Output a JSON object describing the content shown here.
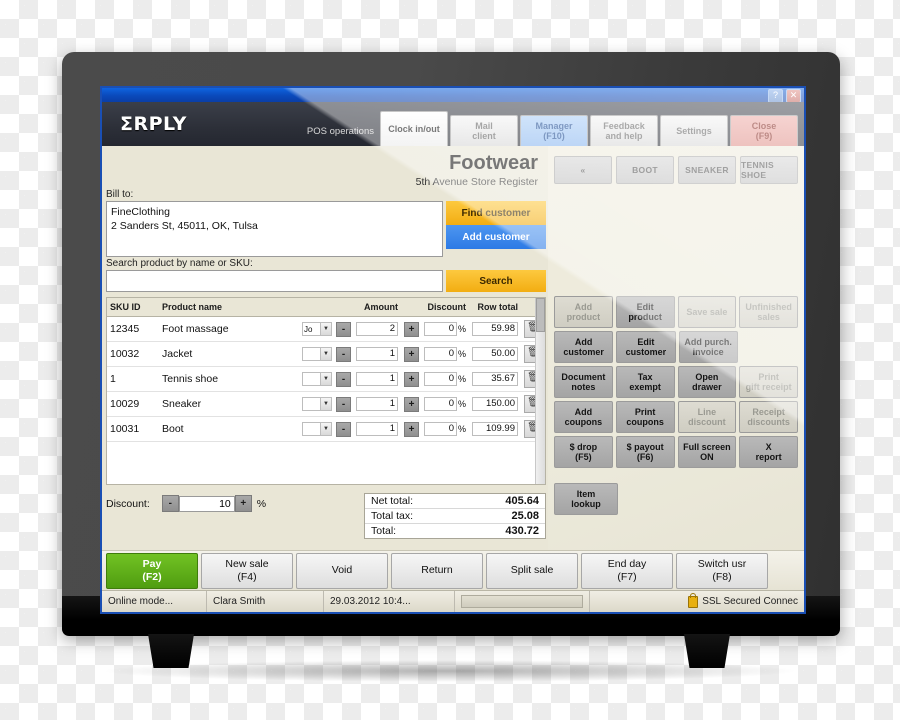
{
  "window": {
    "help_label": "?",
    "close_label": "✕"
  },
  "header": {
    "logo": "ΣRPLY",
    "pos_operations_label": "POS operations",
    "nav": [
      {
        "label": "Clock in/out",
        "sub": "",
        "style": "active"
      },
      {
        "label": "Mail",
        "sub": "client",
        "style": "normal"
      },
      {
        "label": "Manager",
        "sub": "(F10)",
        "style": "blue"
      },
      {
        "label": "Feedback",
        "sub": "and help",
        "style": "normal"
      },
      {
        "label": "Settings",
        "sub": "",
        "style": "normal"
      },
      {
        "label": "Close",
        "sub": "(F9)",
        "style": "red"
      }
    ]
  },
  "store": {
    "title": "Footwear",
    "subtitle": "5th Avenue Store Register"
  },
  "customer": {
    "bill_to_label": "Bill to:",
    "name": "FineClothing",
    "address": "2 Sanders St, 45011, OK, Tulsa",
    "find_button": "Find customer",
    "add_button": "Add customer"
  },
  "search": {
    "label": "Search product by name or SKU:",
    "value": "",
    "placeholder": "",
    "button": "Search"
  },
  "products": {
    "columns": [
      "SKU ID",
      "Product name",
      "",
      "",
      "Amount",
      "",
      "Discount",
      "Row total",
      ""
    ],
    "headers": {
      "sku": "SKU ID",
      "name": "Product name",
      "amount": "Amount",
      "discount": "Discount",
      "row_total": "Row total"
    },
    "delete_icon": "🗑",
    "minus_label": "-",
    "plus_label": "+",
    "dropdown_arrow": "▼",
    "percent_symbol": "%",
    "rows": [
      {
        "sku": "12345",
        "name": "Foot massage",
        "variant": "Jo",
        "amount": "2",
        "discount": "0",
        "row_total": "59.98"
      },
      {
        "sku": "10032",
        "name": "Jacket",
        "variant": "",
        "amount": "1",
        "discount": "0",
        "row_total": "50.00"
      },
      {
        "sku": "1",
        "name": "Tennis shoe",
        "variant": "",
        "amount": "1",
        "discount": "0",
        "row_total": "35.67"
      },
      {
        "sku": "10029",
        "name": "Sneaker",
        "variant": "",
        "amount": "1",
        "discount": "0",
        "row_total": "150.00"
      },
      {
        "sku": "10031",
        "name": "Boot",
        "variant": "",
        "amount": "1",
        "discount": "0",
        "row_total": "109.99"
      }
    ]
  },
  "discount": {
    "label": "Discount:",
    "minus_label": "-",
    "plus_label": "+",
    "value": "10",
    "unit": "%"
  },
  "totals": [
    {
      "label": "Net total:",
      "value": "405.64"
    },
    {
      "label": "Total tax:",
      "value": "25.08"
    },
    {
      "label": "Total:",
      "value": "430.72"
    }
  ],
  "actions": [
    {
      "label": "Pay",
      "sub": "(F2)",
      "style": "green"
    },
    {
      "label": "New sale",
      "sub": "(F4)",
      "style": "normal"
    },
    {
      "label": "Void",
      "sub": "",
      "style": "normal"
    },
    {
      "label": "Return",
      "sub": "",
      "style": "normal"
    },
    {
      "label": "Split sale",
      "sub": "",
      "style": "normal"
    },
    {
      "label": "End day",
      "sub": "(F7)",
      "style": "normal"
    },
    {
      "label": "Switch usr",
      "sub": "(F8)",
      "style": "normal"
    }
  ],
  "status": {
    "mode": "Online mode...",
    "user": "Clara Smith",
    "time": "29.03.2012 10:4...",
    "ssl": "SSL Secured Connec"
  },
  "product_tabs": [
    {
      "label": "«"
    },
    {
      "label": "BOOT"
    },
    {
      "label": "SNEAKER"
    },
    {
      "label": "TENNIS SHOE"
    }
  ],
  "function_buttons": [
    [
      {
        "label": "Add product",
        "sub": "",
        "style": "dim"
      },
      {
        "label": "Edit",
        "sub": "product",
        "style": "normal"
      },
      {
        "label": "Save sale",
        "sub": "",
        "style": "dim"
      },
      {
        "label": "Unfinished",
        "sub": "sales",
        "style": "dim"
      }
    ],
    [
      {
        "label": "Add",
        "sub": "customer",
        "style": "normal"
      },
      {
        "label": "Edit",
        "sub": "customer",
        "style": "normal"
      },
      {
        "label": "Add purch.",
        "sub": "invoice",
        "style": "normal"
      },
      {
        "label": "",
        "sub": "",
        "style": "blank"
      }
    ],
    [
      {
        "label": "Document",
        "sub": "notes",
        "style": "normal"
      },
      {
        "label": "Tax",
        "sub": "exempt",
        "style": "normal"
      },
      {
        "label": "Open",
        "sub": "drawer",
        "style": "normal"
      },
      {
        "label": "Print",
        "sub": "gift receipt",
        "style": "dim"
      }
    ],
    [
      {
        "label": "Add",
        "sub": "coupons",
        "style": "normal"
      },
      {
        "label": "Print",
        "sub": "coupons",
        "style": "normal"
      },
      {
        "label": "Line",
        "sub": "discount",
        "style": "dim"
      },
      {
        "label": "Receipt",
        "sub": "discounts",
        "style": "dim"
      }
    ],
    [
      {
        "label": "$ drop",
        "sub": "(F5)",
        "style": "normal"
      },
      {
        "label": "$ payout",
        "sub": "(F6)",
        "style": "normal"
      },
      {
        "label": "Full screen",
        "sub": "ON",
        "style": "normal"
      },
      {
        "label": "X",
        "sub": "report",
        "style": "normal"
      }
    ]
  ],
  "item_lookup": {
    "label": "Item",
    "sub": "lookup"
  },
  "colors": {
    "title_bar_blue": "#0a49bb",
    "header_dark": "#2c2f38",
    "accent_orange": "#f2ad12",
    "accent_blue": "#2c7ae5",
    "pay_green": "#4f9d10",
    "close_red": "#de8b84",
    "screen_bg": "#e9e6d6"
  }
}
